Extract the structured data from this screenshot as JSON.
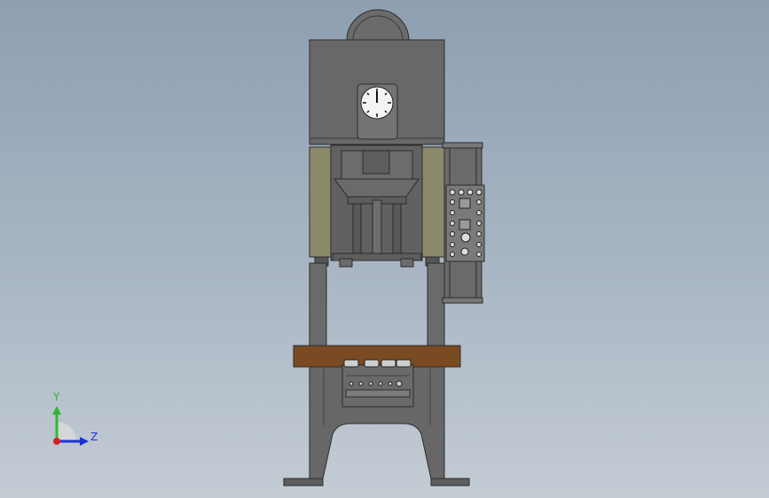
{
  "triad": {
    "y_label": "Y",
    "z_label": "Z",
    "y_color": "#2fb82f",
    "z_color": "#1f2fd8",
    "origin_color": "#d81f1f"
  },
  "colors": {
    "background_top": "#8e9fb2",
    "background_bottom": "#c4ccd4",
    "frame": "#646464",
    "frame_dark": "#3c3c3c",
    "side_plates": "#8a8a6a",
    "bolster": "#7a4a22"
  },
  "icons": {
    "gauge": "dial-gauge-icon",
    "control_panel": "control-panel-icon",
    "triad": "axis-triad-icon"
  }
}
